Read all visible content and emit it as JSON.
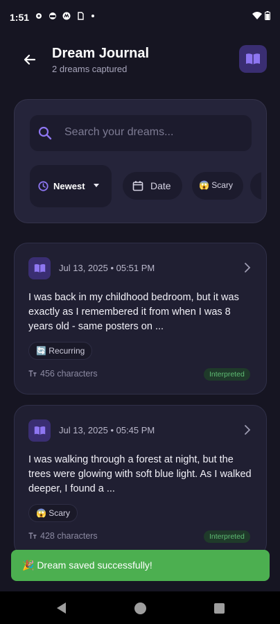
{
  "status_bar": {
    "time": "1:51",
    "left_icons": [
      "gear-icon",
      "cloud-icon",
      "motorola-icon",
      "sim-icon",
      "dot-icon"
    ],
    "right_icons": [
      "wifi-icon",
      "battery-icon"
    ]
  },
  "header": {
    "title": "Dream Journal",
    "subtitle": "2 dreams captured",
    "back_icon": "back-arrow-icon",
    "action_icon": "book-icon"
  },
  "search": {
    "placeholder": "Search your dreams..."
  },
  "filters": {
    "sort_label": "Newest",
    "date_label": "Date",
    "scary_label": "😱 Scary"
  },
  "dreams": [
    {
      "date": "Jul 13, 2025 • 05:51 PM",
      "excerpt": "I was back in my childhood bedroom, but it was exactly as I remembered it from when I was 8 years old - same posters on ...",
      "tag": "🔄 Recurring",
      "characters": "456 characters",
      "status": "Interpreted"
    },
    {
      "date": "Jul 13, 2025 • 05:45 PM",
      "excerpt": "I was walking through a forest at night, but the trees were glowing with soft blue light. As I walked deeper, I found a ...",
      "tag": "😱 Scary",
      "characters": "428 characters",
      "status": "Interpreted"
    }
  ],
  "toast": {
    "message": "🎉 Dream saved successfully!"
  },
  "colors": {
    "background": "#161522",
    "accent": "#7B5CF0",
    "toast": "#4CAF50",
    "interpreted": "#5FBD74"
  }
}
